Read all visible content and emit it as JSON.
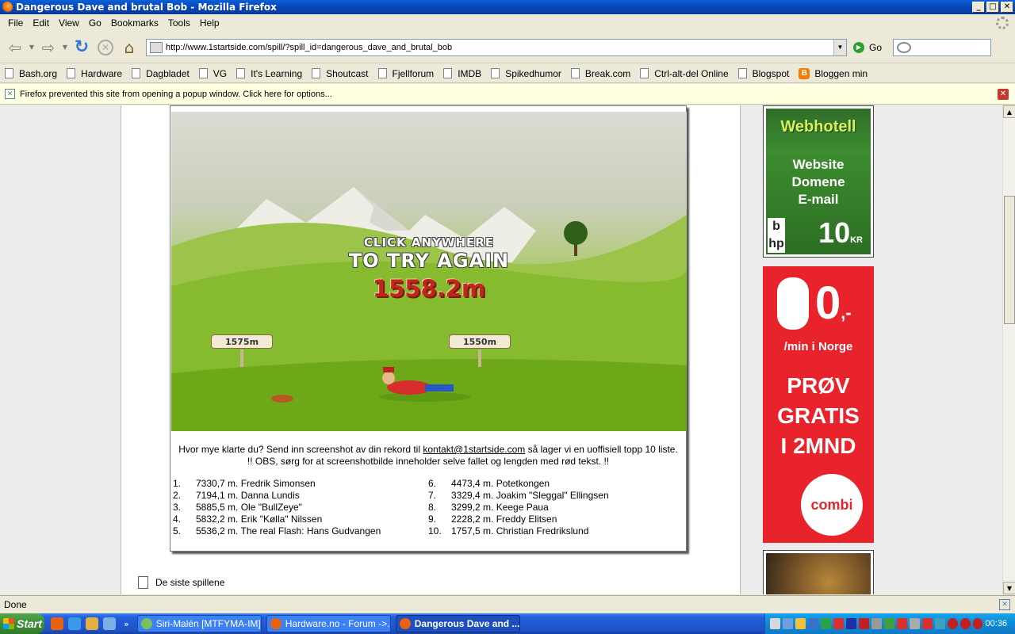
{
  "window": {
    "title": "Dangerous Dave and brutal Bob - Mozilla Firefox",
    "buttons": {
      "minimize": "_",
      "maximize": "□",
      "close": "✕"
    }
  },
  "menu": [
    "File",
    "Edit",
    "View",
    "Go",
    "Bookmarks",
    "Tools",
    "Help"
  ],
  "nav": {
    "url": "http://www.1startside.com/spill/?spill_id=dangerous_dave_and_brutal_bob",
    "go_label": "Go"
  },
  "bookmarks": [
    {
      "label": "Bash.org",
      "icon": "page-icon"
    },
    {
      "label": "Hardware",
      "icon": "page-icon"
    },
    {
      "label": "Dagbladet",
      "icon": "page-icon"
    },
    {
      "label": "VG",
      "icon": "page-icon"
    },
    {
      "label": "It's Learning",
      "icon": "page-icon"
    },
    {
      "label": "Shoutcast",
      "icon": "page-icon"
    },
    {
      "label": "Fjellforum",
      "icon": "page-icon"
    },
    {
      "label": "IMDB",
      "icon": "page-icon"
    },
    {
      "label": "Spikedhumor",
      "icon": "page-icon"
    },
    {
      "label": "Break.com",
      "icon": "page-icon"
    },
    {
      "label": "Ctrl-alt-del Online",
      "icon": "page-icon"
    },
    {
      "label": "Blogspot",
      "icon": "page-icon"
    },
    {
      "label": "Bloggen min",
      "icon": "blogger-icon"
    }
  ],
  "popup_notice": "Firefox prevented this site from opening a popup window. Click here for options...",
  "game": {
    "line1": "CLICK ANYWHERE",
    "line2": "TO TRY AGAIN",
    "score": "1558.2m",
    "sign_left": "1575m",
    "sign_right": "1550m"
  },
  "caption": {
    "before_link": "Hvor mye klarte du? Send inn screenshot av din rekord til ",
    "link": "kontakt@1startside.com",
    "after_link": " så lager vi en uoffisiell topp 10 liste.",
    "line2": "!! OBS, sørg for at screenshotbilde inneholder selve fallet og lengden med rød tekst. !!"
  },
  "toplist": [
    {
      "rank": "1.",
      "entry": "7330,7 m. Fredrik Simonsen"
    },
    {
      "rank": "2.",
      "entry": "7194,1 m. Danna Lundis"
    },
    {
      "rank": "3.",
      "entry": "5885,5 m. Ole \"BullZeye\""
    },
    {
      "rank": "4.",
      "entry": "5832,2 m. Erik \"Kølla\" Nilssen"
    },
    {
      "rank": "5.",
      "entry": "5536,2 m. The real Flash: Hans Gudvangen"
    },
    {
      "rank": "6.",
      "entry": "4473,4 m. Potetkongen"
    },
    {
      "rank": "7.",
      "entry": "3329,4 m. Joakim \"Sleggal\" Ellingsen"
    },
    {
      "rank": "8.",
      "entry": "3299,2 m. Keege Paua"
    },
    {
      "rank": "9.",
      "entry": "2228,2 m. Freddy Elitsen"
    },
    {
      "rank": "10.",
      "entry": "1757,5 m. Christian Fredrikslund"
    }
  ],
  "siste_label": "De siste spillene",
  "ads": {
    "webhotell": {
      "title": "Webhotell",
      "line1": "Website",
      "line2": "Domene",
      "line3": "E-mail",
      "price": "10",
      "currency": "KR"
    },
    "combi": {
      "price": "0",
      "suffix": ",-",
      "per_minute": "/min i Norge",
      "cta1": "PRØV",
      "cta2": "GRATIS",
      "cta3": "I 2MND",
      "brand": "combi"
    }
  },
  "status": "Done",
  "taskbar": {
    "start": "Start",
    "tasks": [
      {
        "label": "Siri-Malén [MTFYMA-IM] ...",
        "active": false
      },
      {
        "label": "Hardware.no - Forum ->...",
        "active": false
      },
      {
        "label": "Dangerous Dave and ...",
        "active": true
      }
    ],
    "clock": "00:36",
    "more": "»"
  },
  "colors": {
    "score_red": "#c0261c",
    "ad_red": "#e8232b",
    "titlebar_blue": "#0842b0"
  }
}
